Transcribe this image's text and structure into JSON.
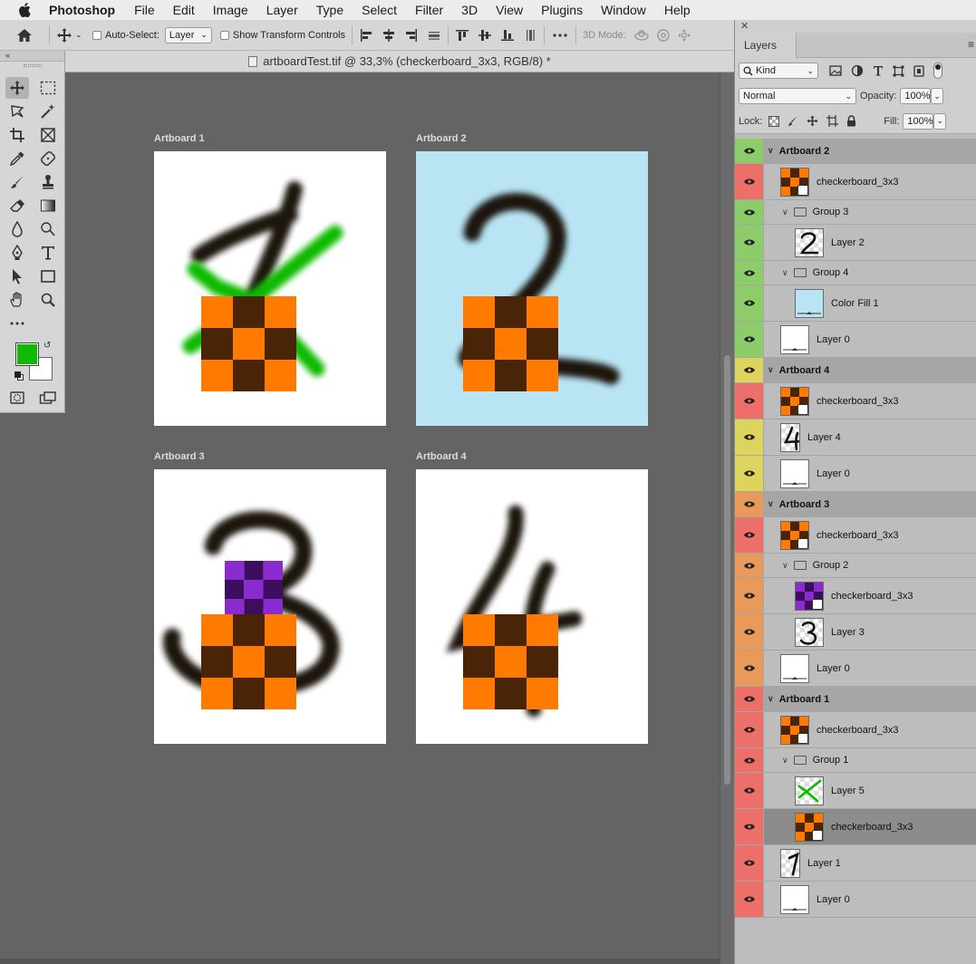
{
  "menubar": {
    "app_name": "Photoshop",
    "items": [
      "File",
      "Edit",
      "Image",
      "Layer",
      "Type",
      "Select",
      "Filter",
      "3D",
      "View",
      "Plugins",
      "Window",
      "Help"
    ]
  },
  "options_bar": {
    "auto_select_label": "Auto-Select:",
    "auto_select_value": "Layer",
    "show_transform_label": "Show Transform Controls",
    "mode_3d_label": "3D Mode:"
  },
  "document": {
    "tab_title": "artboardTest.tif @ 33,3% (checkerboard_3x3, RGB/8) *"
  },
  "colors": {
    "foreground": "#0fba00",
    "background": "#ffffff",
    "orange": "#ff7a00",
    "brown": "#4a2406",
    "purple_light": "#8a2bd0",
    "purple_dark": "#3d0d5e"
  },
  "artboards": [
    {
      "label": "Artboard 1",
      "background": "#ffffff"
    },
    {
      "label": "Artboard 2",
      "background": "#b8e4f4"
    },
    {
      "label": "Artboard 3",
      "background": "#ffffff"
    },
    {
      "label": "Artboard 4",
      "background": "#ffffff"
    }
  ],
  "layers_panel": {
    "tab_label": "Layers",
    "filter_kind": "Kind",
    "blend_mode": "Normal",
    "opacity_label": "Opacity:",
    "opacity_value": "100%",
    "lock_label": "Lock:",
    "fill_label": "Fill:",
    "fill_value": "100%",
    "rows": [
      {
        "type": "artboard",
        "name": "Artboard 2",
        "color": "#8ccd6a",
        "height": 28
      },
      {
        "type": "layer",
        "name": "checkerboard_3x3",
        "thumb": "checker-orange",
        "color": "#ec6f6a",
        "indent": 0,
        "height": 40
      },
      {
        "type": "group",
        "name": "Group 3",
        "color": "#8ccd6a",
        "indent": 0,
        "height": 27
      },
      {
        "type": "layer",
        "name": "Layer 2",
        "thumb": "digit-2",
        "color": "#8ccd6a",
        "indent": 1,
        "height": 40
      },
      {
        "type": "group",
        "name": "Group 4",
        "color": "#8ccd6a",
        "indent": 0,
        "height": 27
      },
      {
        "type": "layer",
        "name": "Color Fill 1",
        "thumb": "fill-blue",
        "color": "#8ccd6a",
        "indent": 1,
        "height": 40
      },
      {
        "type": "layer",
        "name": "Layer 0",
        "thumb": "fill-white",
        "color": "#8ccd6a",
        "indent": 0,
        "height": 40
      },
      {
        "type": "artboard",
        "name": "Artboard 4",
        "color": "#dcd45c",
        "height": 28
      },
      {
        "type": "layer",
        "name": "checkerboard_3x3",
        "thumb": "checker-orange",
        "color": "#ec6f6a",
        "indent": 0,
        "height": 40
      },
      {
        "type": "layer",
        "name": "Layer 4",
        "thumb": "digit-4",
        "color": "#dcd45c",
        "indent": 0,
        "height": 40,
        "narrow": true
      },
      {
        "type": "layer",
        "name": "Layer 0",
        "thumb": "fill-white",
        "color": "#dcd45c",
        "indent": 0,
        "height": 40
      },
      {
        "type": "artboard",
        "name": "Artboard 3",
        "color": "#e99a5a",
        "height": 28
      },
      {
        "type": "layer",
        "name": "checkerboard_3x3",
        "thumb": "checker-orange",
        "color": "#ec6f6a",
        "indent": 0,
        "height": 40
      },
      {
        "type": "group",
        "name": "Group 2",
        "color": "#e99a5a",
        "indent": 0,
        "height": 27
      },
      {
        "type": "layer",
        "name": "checkerboard_3x3",
        "thumb": "checker-purple",
        "color": "#e99a5a",
        "indent": 1,
        "height": 40
      },
      {
        "type": "layer",
        "name": "Layer 3",
        "thumb": "digit-3",
        "color": "#e99a5a",
        "indent": 1,
        "height": 40
      },
      {
        "type": "layer",
        "name": "Layer 0",
        "thumb": "fill-white",
        "color": "#e99a5a",
        "indent": 0,
        "height": 40
      },
      {
        "type": "artboard",
        "name": "Artboard 1",
        "color": "#ec6f6a",
        "height": 28
      },
      {
        "type": "layer",
        "name": "checkerboard_3x3",
        "thumb": "checker-orange",
        "color": "#ec6f6a",
        "indent": 0,
        "height": 40
      },
      {
        "type": "group",
        "name": "Group 1",
        "color": "#ec6f6a",
        "indent": 0,
        "height": 27
      },
      {
        "type": "layer",
        "name": "Layer 5",
        "thumb": "green-x",
        "color": "#ec6f6a",
        "indent": 1,
        "height": 40
      },
      {
        "type": "layer",
        "name": "checkerboard_3x3",
        "thumb": "checker-orange",
        "color": "#ec6f6a",
        "indent": 1,
        "height": 40,
        "selected": true
      },
      {
        "type": "layer",
        "name": "Layer 1",
        "thumb": "digit-1",
        "color": "#ec6f6a",
        "indent": 0,
        "height": 40,
        "narrow": true
      },
      {
        "type": "layer",
        "name": "Layer 0",
        "thumb": "fill-white",
        "color": "#ec6f6a",
        "indent": 0,
        "height": 40
      }
    ]
  }
}
